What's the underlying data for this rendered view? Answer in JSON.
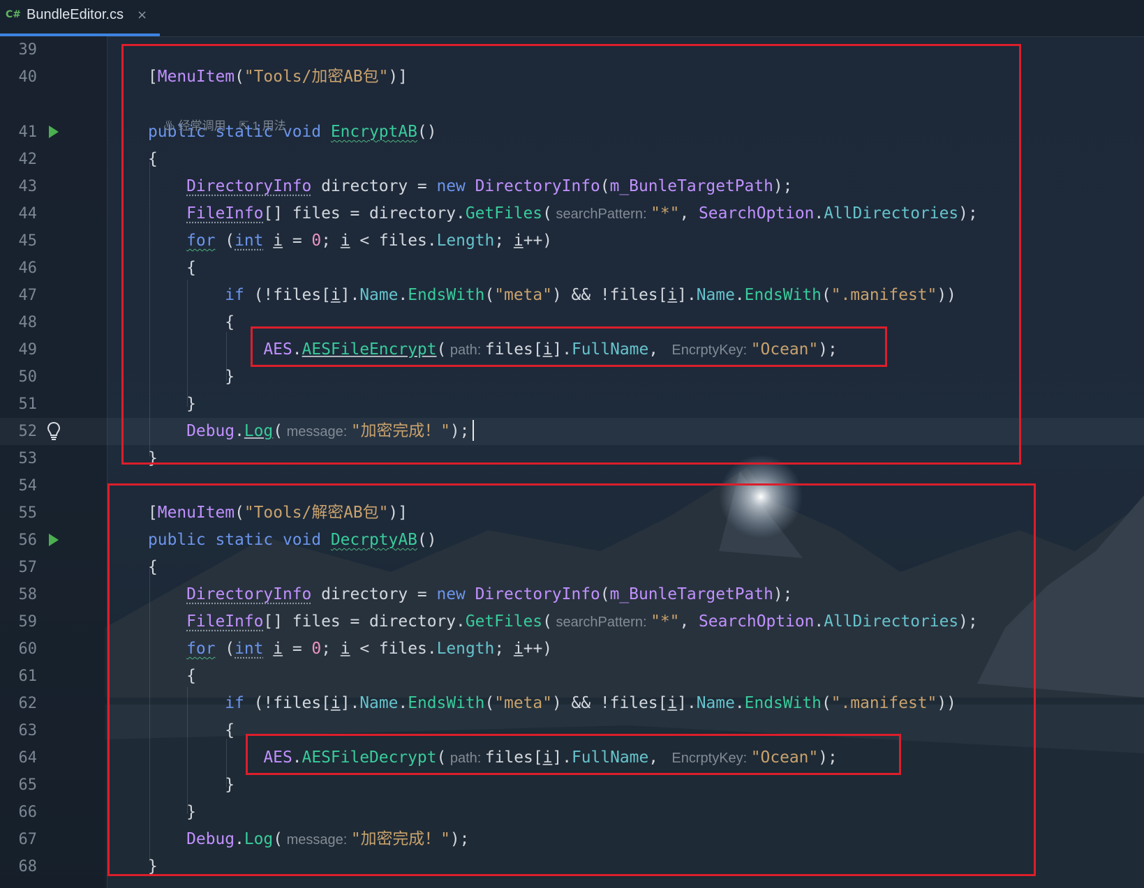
{
  "editor": {
    "tab": {
      "language_icon": "C#",
      "title": "BundleEditor.cs",
      "close_label": "×"
    },
    "hints": [
      {
        "icon": "flame-icon",
        "label": "经常调用"
      },
      {
        "icon": "usage-icon",
        "label": "1 用法"
      }
    ],
    "line_numbers": [
      "39",
      "40",
      "41",
      "42",
      "43",
      "44",
      "45",
      "46",
      "47",
      "48",
      "49",
      "50",
      "51",
      "52",
      "53",
      "54",
      "55",
      "56",
      "57",
      "58",
      "59",
      "60",
      "61",
      "62",
      "63",
      "64",
      "65",
      "66",
      "67",
      "68"
    ],
    "gutter_icons": {
      "41": "run-icon",
      "52": "lightbulb-icon",
      "56": "run-icon"
    },
    "current_line": "52",
    "code_lines": {
      "39": [],
      "40": [
        {
          "t": "[",
          "c": "pn"
        },
        {
          "t": "MenuItem",
          "c": "ty"
        },
        {
          "t": "(",
          "c": "pn"
        },
        {
          "t": "\"Tools/加密AB包\"",
          "c": "st"
        },
        {
          "t": ")]",
          "c": "pn"
        }
      ],
      "41": [
        {
          "t": "public static void ",
          "c": "kw"
        },
        {
          "t": "EncryptAB",
          "c": "mt sq"
        },
        {
          "t": "()",
          "c": "pn"
        }
      ],
      "42": [
        {
          "t": "{",
          "c": "pn"
        }
      ],
      "43": [
        {
          "t": "    ",
          "c": "pn"
        },
        {
          "t": "DirectoryInfo",
          "c": "ty dot"
        },
        {
          "t": " directory = ",
          "c": "pn"
        },
        {
          "t": "new ",
          "c": "kw"
        },
        {
          "t": "DirectoryInfo",
          "c": "ty"
        },
        {
          "t": "(",
          "c": "pn"
        },
        {
          "t": "m_BunleTargetPath",
          "c": "ty"
        },
        {
          "t": ");",
          "c": "pn"
        }
      ],
      "44": [
        {
          "t": "    ",
          "c": "pn"
        },
        {
          "t": "FileInfo",
          "c": "ty dot"
        },
        {
          "t": "[] files = directory.",
          "c": "pn"
        },
        {
          "t": "GetFiles",
          "c": "mt"
        },
        {
          "t": "(",
          "c": "pn"
        },
        {
          "t": " searchPattern: ",
          "c": "hint"
        },
        {
          "t": "\"*\"",
          "c": "st"
        },
        {
          "t": ", ",
          "c": "pn"
        },
        {
          "t": "SearchOption",
          "c": "ty"
        },
        {
          "t": ".",
          "c": "pn"
        },
        {
          "t": "AllDirectories",
          "c": "pr"
        },
        {
          "t": ");",
          "c": "pn"
        }
      ],
      "45": [
        {
          "t": "    ",
          "c": "pn"
        },
        {
          "t": "for",
          "c": "kw sq"
        },
        {
          "t": " (",
          "c": "pn"
        },
        {
          "t": "int",
          "c": "kw dot"
        },
        {
          "t": " ",
          "c": "pn"
        },
        {
          "t": "i",
          "c": "pn u"
        },
        {
          "t": " = ",
          "c": "pn"
        },
        {
          "t": "0",
          "c": "nm"
        },
        {
          "t": "; ",
          "c": "pn"
        },
        {
          "t": "i",
          "c": "pn u"
        },
        {
          "t": " < files.",
          "c": "pn"
        },
        {
          "t": "Length",
          "c": "pr"
        },
        {
          "t": "; ",
          "c": "pn"
        },
        {
          "t": "i",
          "c": "pn u"
        },
        {
          "t": "++)",
          "c": "pn"
        }
      ],
      "46": [
        {
          "t": "    {",
          "c": "pn"
        }
      ],
      "47": [
        {
          "t": "        ",
          "c": "pn"
        },
        {
          "t": "if",
          "c": "kw"
        },
        {
          "t": " (!files[",
          "c": "pn"
        },
        {
          "t": "i",
          "c": "pn u"
        },
        {
          "t": "].",
          "c": "pn"
        },
        {
          "t": "Name",
          "c": "pr"
        },
        {
          "t": ".",
          "c": "pn"
        },
        {
          "t": "EndsWith",
          "c": "mt"
        },
        {
          "t": "(",
          "c": "pn"
        },
        {
          "t": "\"meta\"",
          "c": "st"
        },
        {
          "t": ") && !files[",
          "c": "pn"
        },
        {
          "t": "i",
          "c": "pn u"
        },
        {
          "t": "].",
          "c": "pn"
        },
        {
          "t": "Name",
          "c": "pr"
        },
        {
          "t": ".",
          "c": "pn"
        },
        {
          "t": "EndsWith",
          "c": "mt"
        },
        {
          "t": "(",
          "c": "pn"
        },
        {
          "t": "\".manifest\"",
          "c": "st"
        },
        {
          "t": "))",
          "c": "pn"
        }
      ],
      "48": [
        {
          "t": "        {",
          "c": "pn"
        }
      ],
      "49": [
        {
          "t": "            ",
          "c": "pn"
        },
        {
          "t": "AES",
          "c": "ty"
        },
        {
          "t": ".",
          "c": "pn"
        },
        {
          "t": "AESFileEncrypt",
          "c": "mt u"
        },
        {
          "t": "(",
          "c": "pn"
        },
        {
          "t": " path: ",
          "c": "hint"
        },
        {
          "t": "files[",
          "c": "pn"
        },
        {
          "t": "i",
          "c": "pn u"
        },
        {
          "t": "].",
          "c": "pn"
        },
        {
          "t": "FullName",
          "c": "pr"
        },
        {
          "t": ", ",
          "c": "pn"
        },
        {
          "t": " EncrptyKey: ",
          "c": "hint"
        },
        {
          "t": "\"Ocean\"",
          "c": "st"
        },
        {
          "t": ");",
          "c": "pn"
        }
      ],
      "50": [
        {
          "t": "        }",
          "c": "pn"
        }
      ],
      "51": [
        {
          "t": "    }",
          "c": "pn"
        }
      ],
      "52": [
        {
          "t": "    ",
          "c": "pn"
        },
        {
          "t": "Debug",
          "c": "ty"
        },
        {
          "t": ".",
          "c": "pn"
        },
        {
          "t": "Log",
          "c": "mt u"
        },
        {
          "t": "(",
          "c": "pn"
        },
        {
          "t": " message: ",
          "c": "hint"
        },
        {
          "t": "\"加密完成！\"",
          "c": "st"
        },
        {
          "t": ");",
          "c": "pn"
        }
      ],
      "53": [
        {
          "t": "}",
          "c": "pn"
        }
      ],
      "54": [],
      "55": [
        {
          "t": "[",
          "c": "pn"
        },
        {
          "t": "MenuItem",
          "c": "ty"
        },
        {
          "t": "(",
          "c": "pn"
        },
        {
          "t": "\"Tools/解密AB包\"",
          "c": "st"
        },
        {
          "t": ")]",
          "c": "pn"
        }
      ],
      "56": [
        {
          "t": "public static void ",
          "c": "kw"
        },
        {
          "t": "DecrptyAB",
          "c": "mt sq"
        },
        {
          "t": "()",
          "c": "pn"
        }
      ],
      "57": [
        {
          "t": "{",
          "c": "pn"
        }
      ],
      "58": [
        {
          "t": "    ",
          "c": "pn"
        },
        {
          "t": "DirectoryInfo",
          "c": "ty dot"
        },
        {
          "t": " directory = ",
          "c": "pn"
        },
        {
          "t": "new ",
          "c": "kw"
        },
        {
          "t": "DirectoryInfo",
          "c": "ty"
        },
        {
          "t": "(",
          "c": "pn"
        },
        {
          "t": "m_BunleTargetPath",
          "c": "ty"
        },
        {
          "t": ");",
          "c": "pn"
        }
      ],
      "59": [
        {
          "t": "    ",
          "c": "pn"
        },
        {
          "t": "FileInfo",
          "c": "ty dot"
        },
        {
          "t": "[] files = directory.",
          "c": "pn"
        },
        {
          "t": "GetFiles",
          "c": "mt"
        },
        {
          "t": "(",
          "c": "pn"
        },
        {
          "t": " searchPattern: ",
          "c": "hint"
        },
        {
          "t": "\"*\"",
          "c": "st"
        },
        {
          "t": ", ",
          "c": "pn"
        },
        {
          "t": "SearchOption",
          "c": "ty"
        },
        {
          "t": ".",
          "c": "pn"
        },
        {
          "t": "AllDirectories",
          "c": "pr"
        },
        {
          "t": ");",
          "c": "pn"
        }
      ],
      "60": [
        {
          "t": "    ",
          "c": "pn"
        },
        {
          "t": "for",
          "c": "kw sq"
        },
        {
          "t": " (",
          "c": "pn"
        },
        {
          "t": "int",
          "c": "kw dot"
        },
        {
          "t": " ",
          "c": "pn"
        },
        {
          "t": "i",
          "c": "pn u"
        },
        {
          "t": " = ",
          "c": "pn"
        },
        {
          "t": "0",
          "c": "nm"
        },
        {
          "t": "; ",
          "c": "pn"
        },
        {
          "t": "i",
          "c": "pn u"
        },
        {
          "t": " < files.",
          "c": "pn"
        },
        {
          "t": "Length",
          "c": "pr"
        },
        {
          "t": "; ",
          "c": "pn"
        },
        {
          "t": "i",
          "c": "pn u"
        },
        {
          "t": "++)",
          "c": "pn"
        }
      ],
      "61": [
        {
          "t": "    {",
          "c": "pn"
        }
      ],
      "62": [
        {
          "t": "        ",
          "c": "pn"
        },
        {
          "t": "if",
          "c": "kw"
        },
        {
          "t": " (!files[",
          "c": "pn"
        },
        {
          "t": "i",
          "c": "pn u"
        },
        {
          "t": "].",
          "c": "pn"
        },
        {
          "t": "Name",
          "c": "pr"
        },
        {
          "t": ".",
          "c": "pn"
        },
        {
          "t": "EndsWith",
          "c": "mt"
        },
        {
          "t": "(",
          "c": "pn"
        },
        {
          "t": "\"meta\"",
          "c": "st"
        },
        {
          "t": ") && !files[",
          "c": "pn"
        },
        {
          "t": "i",
          "c": "pn u"
        },
        {
          "t": "].",
          "c": "pn"
        },
        {
          "t": "Name",
          "c": "pr"
        },
        {
          "t": ".",
          "c": "pn"
        },
        {
          "t": "EndsWith",
          "c": "mt"
        },
        {
          "t": "(",
          "c": "pn"
        },
        {
          "t": "\".manifest\"",
          "c": "st"
        },
        {
          "t": "))",
          "c": "pn"
        }
      ],
      "63": [
        {
          "t": "        {",
          "c": "pn"
        }
      ],
      "64": [
        {
          "t": "            ",
          "c": "pn"
        },
        {
          "t": "AES",
          "c": "ty"
        },
        {
          "t": ".",
          "c": "pn"
        },
        {
          "t": "AESFileDecrypt",
          "c": "mt"
        },
        {
          "t": "(",
          "c": "pn"
        },
        {
          "t": " path: ",
          "c": "hint"
        },
        {
          "t": "files[",
          "c": "pn"
        },
        {
          "t": "i",
          "c": "pn u"
        },
        {
          "t": "].",
          "c": "pn"
        },
        {
          "t": "FullName",
          "c": "pr"
        },
        {
          "t": ", ",
          "c": "pn"
        },
        {
          "t": " EncrptyKey: ",
          "c": "hint"
        },
        {
          "t": "\"Ocean\"",
          "c": "st"
        },
        {
          "t": ");",
          "c": "pn"
        }
      ],
      "65": [
        {
          "t": "        }",
          "c": "pn"
        }
      ],
      "66": [
        {
          "t": "    }",
          "c": "pn"
        }
      ],
      "67": [
        {
          "t": "    ",
          "c": "pn"
        },
        {
          "t": "Debug",
          "c": "ty"
        },
        {
          "t": ".",
          "c": "pn"
        },
        {
          "t": "Log",
          "c": "mt"
        },
        {
          "t": "(",
          "c": "pn"
        },
        {
          "t": " message: ",
          "c": "hint"
        },
        {
          "t": "\"加密完成！\"",
          "c": "st"
        },
        {
          "t": ");",
          "c": "pn"
        }
      ],
      "68": [
        {
          "t": "}",
          "c": "pn"
        }
      ]
    },
    "colors": {
      "keyword": "#6c95eb",
      "type": "#c191ff",
      "method": "#39cc9b",
      "property": "#66c3cc",
      "string": "#c9a26d",
      "number": "#ed94c0",
      "highlight_box": "#dc1e2b",
      "tab_underline": "#3d83e0"
    }
  }
}
